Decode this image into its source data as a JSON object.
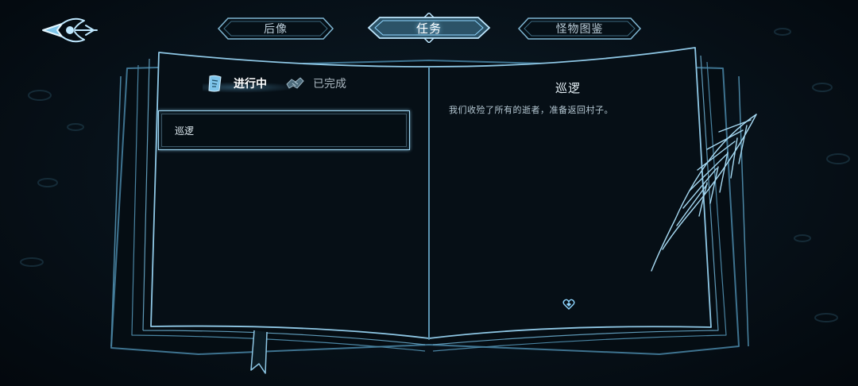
{
  "header": {
    "tabs": [
      {
        "id": "afterimage",
        "label": "后像",
        "active": false
      },
      {
        "id": "quests",
        "label": "任务",
        "active": true
      },
      {
        "id": "bestiary",
        "label": "怪物图鉴",
        "active": false
      }
    ],
    "back_icon": "winged-back-arrow-icon"
  },
  "quest_log": {
    "filters": [
      {
        "label": "进行中",
        "icon": "scroll-icon",
        "selected": true
      },
      {
        "label": "已完成",
        "icon": "handshake-icon",
        "selected": false
      }
    ],
    "items": [
      {
        "title": "巡逻",
        "selected": true
      }
    ]
  },
  "detail": {
    "title": "巡逻",
    "description": "我们收殓了所有的逝者，准备返回村子。"
  },
  "colors": {
    "glow": "#8fd6ff",
    "outline": "#9fd6f2",
    "background": "#071119"
  }
}
